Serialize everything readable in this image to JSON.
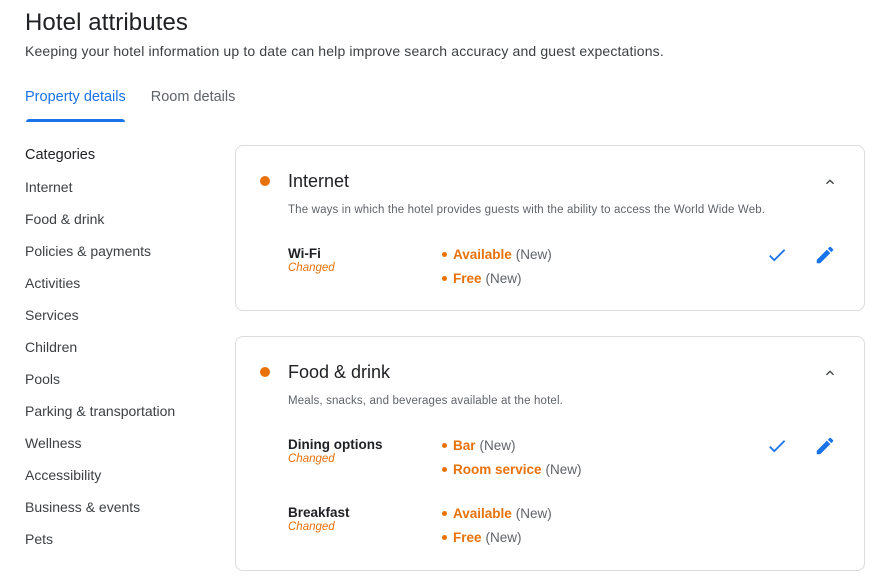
{
  "header": {
    "title": "Hotel attributes",
    "subtitle": "Keeping your hotel information up to date can help improve search accuracy and guest expectations."
  },
  "tabs": [
    {
      "label": "Property details",
      "active": true
    },
    {
      "label": "Room details",
      "active": false
    }
  ],
  "sidebar": {
    "heading": "Categories",
    "items": [
      {
        "label": "Internet"
      },
      {
        "label": "Food & drink"
      },
      {
        "label": "Policies & payments"
      },
      {
        "label": "Activities"
      },
      {
        "label": "Services"
      },
      {
        "label": "Children"
      },
      {
        "label": "Pools"
      },
      {
        "label": "Parking & transportation"
      },
      {
        "label": "Wellness"
      },
      {
        "label": "Accessibility"
      },
      {
        "label": "Business & events"
      },
      {
        "label": "Pets"
      }
    ]
  },
  "colors": {
    "accent": "#1a73e8",
    "changed": "#e8710a",
    "text_primary": "#202124",
    "text_secondary": "#5f6368",
    "border": "#dadce0"
  },
  "icons": {
    "collapse": "chevron-up-icon",
    "confirm": "check-icon",
    "edit": "pencil-icon",
    "status": "dot-icon"
  },
  "sections": [
    {
      "title": "Internet",
      "description": "The ways in which the hotel provides guests with the ability to access the World Wide Web.",
      "attributes": [
        {
          "name": "Wi-Fi",
          "status": "Changed",
          "values": [
            {
              "label": "Available",
              "status": "(New)"
            },
            {
              "label": "Free",
              "status": "(New)"
            }
          ]
        }
      ]
    },
    {
      "title": "Food & drink",
      "description": "Meals, snacks, and beverages available at the hotel.",
      "attributes": [
        {
          "name": "Dining options",
          "status": "Changed",
          "values": [
            {
              "label": "Bar",
              "status": "(New)"
            },
            {
              "label": "Room service",
              "status": "(New)"
            }
          ]
        },
        {
          "name": "Breakfast",
          "status": "Changed",
          "values": [
            {
              "label": "Available",
              "status": "(New)"
            },
            {
              "label": "Free",
              "status": "(New)"
            }
          ]
        }
      ]
    }
  ]
}
